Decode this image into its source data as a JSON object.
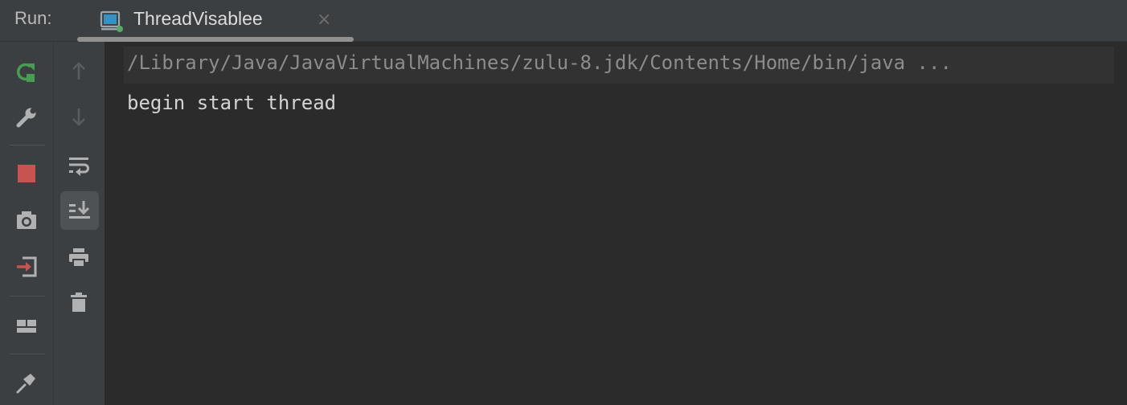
{
  "toolwindow": {
    "run_label": "Run:",
    "tab": {
      "title": "ThreadVisablee",
      "close_glyph": "×",
      "icon": "console-icon"
    }
  },
  "toolbar_left": [
    {
      "name": "rerun-icon"
    },
    {
      "name": "wrench-icon"
    },
    {
      "name": "stop-icon",
      "color": "#c75450"
    },
    {
      "name": "camera-icon"
    },
    {
      "name": "exit-icon",
      "color": "#c75450"
    },
    {
      "name": "layout-icon"
    },
    {
      "name": "pin-icon"
    }
  ],
  "toolbar_right": [
    {
      "name": "arrow-up-icon",
      "enabled": false
    },
    {
      "name": "arrow-down-icon",
      "enabled": false
    },
    {
      "name": "soft-wrap-icon"
    },
    {
      "name": "scroll-to-end-icon",
      "toggled": true
    },
    {
      "name": "print-icon"
    },
    {
      "name": "trash-icon"
    }
  ],
  "console": {
    "command_line": "/Library/Java/JavaVirtualMachines/zulu-8.jdk/Contents/Home/bin/java ...",
    "output": [
      "begin start thread"
    ]
  },
  "colors": {
    "background": "#2b2b2b",
    "panel": "#3c3f41",
    "rerun_green": "#499c54",
    "stop_red": "#c75450"
  }
}
